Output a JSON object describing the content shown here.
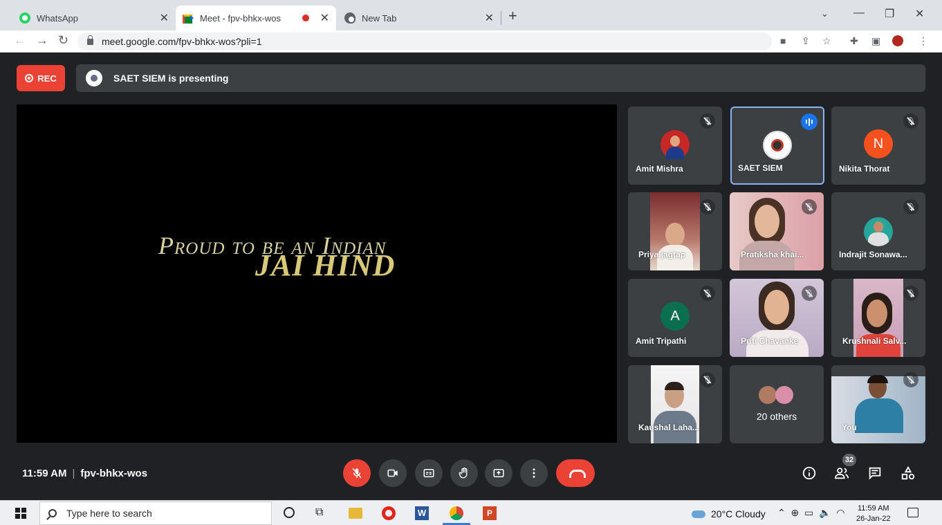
{
  "browser": {
    "tabs": [
      {
        "title": "WhatsApp",
        "icon": "whatsapp-icon"
      },
      {
        "title": "Meet - fpv-bhkx-wos",
        "icon": "google-meet-icon",
        "recording": true
      },
      {
        "title": "New Tab",
        "icon": "chrome-icon"
      }
    ],
    "url": "meet.google.com/fpv-bhkx-wos?pli=1"
  },
  "meet": {
    "rec_label": "REC",
    "presenting_text": "SAET SIEM is presenting",
    "screen_line1": "Proud to be an Indian",
    "screen_line2": "JAI HIND",
    "participants": [
      {
        "name": "Amit Mishra",
        "muted": true
      },
      {
        "name": "SAET SIEM",
        "speaking": true
      },
      {
        "name": "Nikita Thorat",
        "muted": true,
        "initial": "N",
        "avatar_color": "#f4511e"
      },
      {
        "name": "Priya jagtap",
        "muted": true
      },
      {
        "name": "Pratiksha khai...",
        "muted": true
      },
      {
        "name": "Indrajit Sonawa...",
        "muted": true
      },
      {
        "name": "Amit Tripathi",
        "muted": true,
        "initial": "A",
        "avatar_color": "#0b6e4f"
      },
      {
        "name": "Priti Chavanke",
        "muted": true
      },
      {
        "name": "Krushnali Salv...",
        "muted": true
      },
      {
        "name": "Kaushal Laha...",
        "muted": true
      },
      {
        "name": "You",
        "muted": true
      }
    ],
    "others_label": "20 others",
    "time": "11:59 AM",
    "meeting_code": "fpv-bhkx-wos",
    "people_count": "32"
  },
  "taskbar": {
    "search_placeholder": "Type here to search",
    "weather": "20°C  Cloudy",
    "time": "11:59 AM",
    "date": "26-Jan-22"
  }
}
